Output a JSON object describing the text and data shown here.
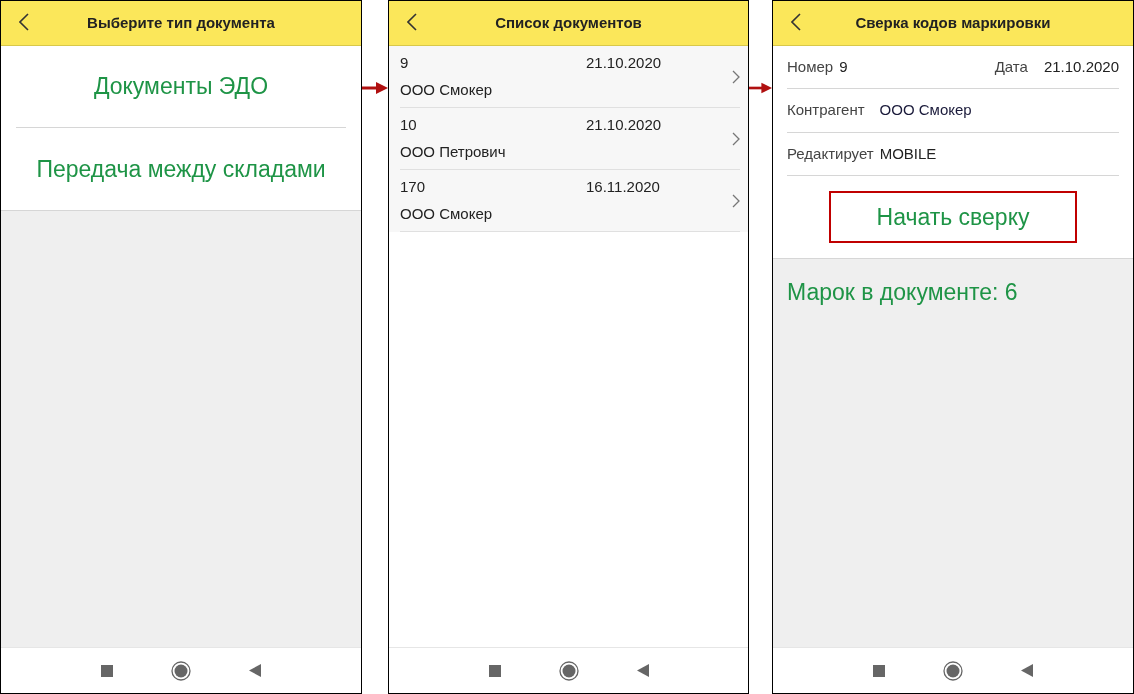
{
  "screens": [
    {
      "kind": "menu",
      "title": "Выберите тип документа",
      "items": [
        {
          "label": "Документы ЭДО"
        },
        {
          "label": "Передача между складами"
        }
      ]
    },
    {
      "kind": "list",
      "title": "Список документов",
      "rows": [
        {
          "number": "9",
          "date": "21.10.2020",
          "name": "ООО Смокер"
        },
        {
          "number": "10",
          "date": "21.10.2020",
          "name": "ООО Петрович"
        },
        {
          "number": "170",
          "date": "16.11.2020",
          "name": "ООО Смокер"
        }
      ]
    },
    {
      "kind": "form",
      "title": "Сверка кодов маркировки",
      "number_label": "Номер",
      "number": "9",
      "date_label": "Дата",
      "date": "21.10.2020",
      "partner_label": "Контрагент",
      "partner": "ООО Смокер",
      "editor_label": "Редактирует",
      "editor": "MOBILE",
      "button": "Начать сверку",
      "summary": "Марок в документе: 6"
    }
  ]
}
